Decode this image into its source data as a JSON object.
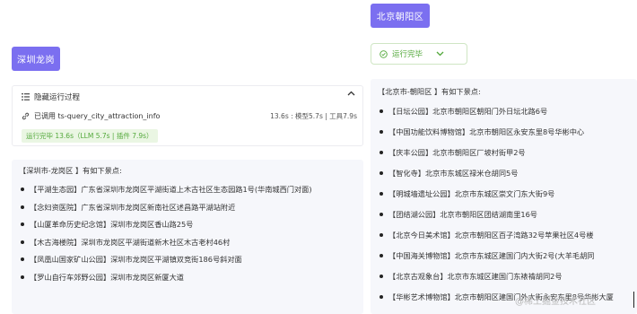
{
  "left": {
    "button_label": "深圳龙岗",
    "process": {
      "toggle_label": "隐藏运行过程",
      "tool_label": "已调用 ts-query_city_attraction_info",
      "tool_timing": "13.6s : 模型5.7s | 工具7.9s",
      "status": "运行完毕 13.6s（LLM 5.7s | 插件 7.9s）"
    },
    "result": {
      "title": "【深圳市-龙岗区 】有如下景点:",
      "items": [
        "【平湖生态园】广东省深圳市龙岗区平湖街道上木古社区生态园路1号(华南城西门对面)",
        "【念妇资医院】广东省深圳市龙岗区新南社区述昌路平湖站附近",
        "【山厦革命历史纪念馆】深圳市龙岗区香山路25号",
        "【木古海楼院】深圳市龙岗区平湖街道新木社区木古老村46村",
        "【凤凰山国家矿山公园】深圳市龙岗区平湖镇双竞街186号斜对面",
        "【罗山自行车郊野公园】深圳市龙岗区新厦大道"
      ]
    }
  },
  "right": {
    "button_label": "北京朝阳区",
    "status_label": "运行完毕",
    "result": {
      "title": "【北京市-朝阳区 】有如下景点:",
      "items": [
        "【日坛公园】北京市朝阳区朝阳门外日坛北路6号",
        "【中国功能饮料博物馆】北京市朝阳区永安东里8号华彬中心",
        "【庆丰公园】北京市朝阳区厂坡村街甲2号",
        "【智化寺】北京市东城区禄米仓胡同5号",
        "【明城墙遗址公园】北京市东城区崇文门东大街9号",
        "【团结湖公园】北京市朝阳区团结湖南里16号",
        "【北京今日美术馆】北京市朝阳区百子湾路32号苹果社区4号楼",
        "【中国海关博物馆】北京市东城区建国门内大街2号(大羊毛胡同",
        "【北京古观象台】北京市东城区建国门东裱褙胡同2号",
        "【华彬艺术博物馆】北京市朝阳区建国门外大街永安东里8号华彬大厦"
      ]
    }
  },
  "watermark": "@稀土掘金技术社区",
  "colors": {
    "accent": "#7b6ff0",
    "success": "#52a83a",
    "panel_bg": "#f6f7fb"
  },
  "icons": {
    "toggle": "list-icon",
    "tool": "link-icon",
    "collapse": "chevron-up-icon",
    "status": "check-circle-icon",
    "dropdown": "chevron-down-icon"
  }
}
